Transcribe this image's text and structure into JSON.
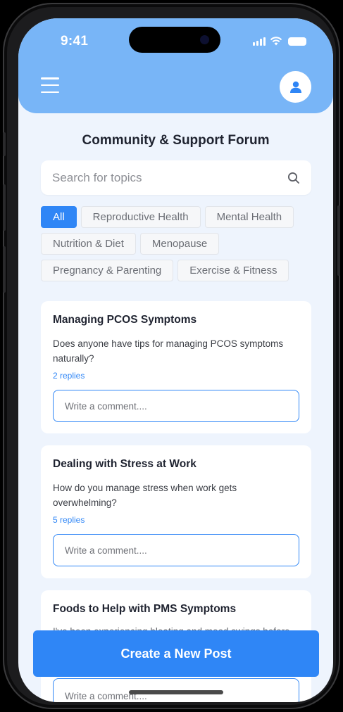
{
  "status_bar": {
    "time": "9:41"
  },
  "header": {
    "menu_icon": "hamburger-menu-icon",
    "profile_icon": "user-profile-icon"
  },
  "page": {
    "title": "Community & Support Forum"
  },
  "search": {
    "placeholder": "Search for topics",
    "icon": "search-icon"
  },
  "categories": [
    {
      "label": "All",
      "active": true
    },
    {
      "label": "Reproductive Health",
      "active": false
    },
    {
      "label": "Mental Health",
      "active": false
    },
    {
      "label": "Nutrition & Diet",
      "active": false
    },
    {
      "label": "Menopause",
      "active": false
    },
    {
      "label": "Pregnancy & Parenting",
      "active": false
    },
    {
      "label": "Exercise & Fitness",
      "active": false
    }
  ],
  "posts": [
    {
      "title": "Managing PCOS Symptoms",
      "body": "Does anyone have tips for managing PCOS symptoms naturally?",
      "replies": "2 replies",
      "comment_placeholder": "Write a comment...."
    },
    {
      "title": "Dealing with Stress at Work",
      "body": "How do you manage stress when work gets overwhelming?",
      "replies": "5 replies",
      "comment_placeholder": "Write a comment...."
    },
    {
      "title": "Foods to Help with PMS Symptoms",
      "body": "I've been experiencing bloating and mood swings before",
      "comment_placeholder": "Write a comment...."
    }
  ],
  "actions": {
    "create_post_label": "Create a New Post"
  },
  "colors": {
    "header": "#78b5f7",
    "accent": "#2f86f6",
    "background": "#eef4fd"
  }
}
